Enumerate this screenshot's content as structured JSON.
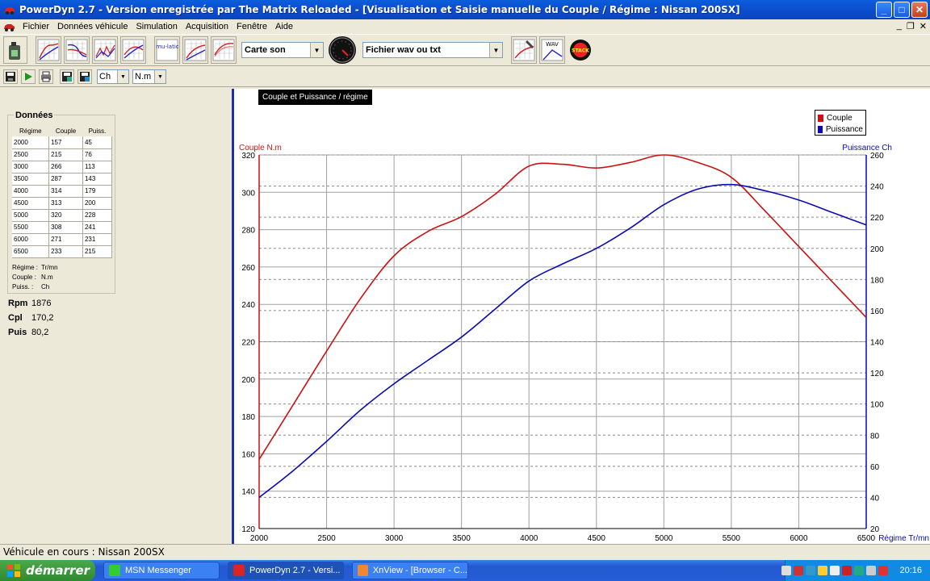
{
  "window": {
    "title": "PowerDyn 2.7 - Version enregistrée par The Matrix Reloaded - [Visualisation et Saisie manuelle du Couple / Régime : Nissan 200SX]",
    "minimize": "_",
    "maximize": "□",
    "close": "✕"
  },
  "menu": {
    "items": [
      "Fichier",
      "Données véhicule",
      "Simulation",
      "Acquisition",
      "Fenêtre",
      "Aide"
    ],
    "mdi_minimize": "_",
    "mdi_restore": "❐",
    "mdi_close": "✕"
  },
  "toolbar": {
    "sound_source": "Carte son",
    "file_source": "Fichier wav ou txt",
    "simulation_label": "simu-lation",
    "wav_label": "WAV",
    "stack_label": "STACK"
  },
  "toolbar2": {
    "power_unit": "Ch",
    "torque_unit": "N.m"
  },
  "panel": {
    "title": "Données",
    "headers": [
      "Régime",
      "Couple",
      "Puiss."
    ],
    "rows": [
      [
        "2000",
        "157",
        "45"
      ],
      [
        "2500",
        "215",
        "76"
      ],
      [
        "3000",
        "266",
        "113"
      ],
      [
        "3500",
        "287",
        "143"
      ],
      [
        "4000",
        "314",
        "179"
      ],
      [
        "4500",
        "313",
        "200"
      ],
      [
        "5000",
        "320",
        "228"
      ],
      [
        "5500",
        "308",
        "241"
      ],
      [
        "6000",
        "271",
        "231"
      ],
      [
        "6500",
        "233",
        "215"
      ]
    ],
    "units": [
      {
        "label": "Régime :",
        "value": "Tr/mn"
      },
      {
        "label": "Couple :",
        "value": "N.m"
      },
      {
        "label": "Puiss. :",
        "value": "Ch"
      }
    ],
    "readouts": [
      {
        "label": "Rpm",
        "value": "1876"
      },
      {
        "label": "Cpl",
        "value": "170,2"
      },
      {
        "label": "Puis",
        "value": "80,2"
      }
    ]
  },
  "chart_data": {
    "type": "line",
    "title": "Couple et Puissance / régime",
    "xlabel": "Régime Tr/mn",
    "ylabel_left": "Couple N.m",
    "ylabel_right": "Puissance Ch",
    "xlim": [
      2000,
      6500
    ],
    "ylim_left": [
      120,
      320
    ],
    "ylim_right": [
      20,
      260
    ],
    "x_ticks": [
      2000,
      2500,
      3000,
      3500,
      4000,
      4500,
      5000,
      5500,
      6000,
      6500
    ],
    "y_ticks_left": [
      120,
      140,
      160,
      180,
      200,
      220,
      240,
      260,
      280,
      300,
      320
    ],
    "y_ticks_right": [
      20,
      40,
      60,
      80,
      100,
      120,
      140,
      160,
      180,
      200,
      220,
      240,
      260
    ],
    "grid": true,
    "legend_position": "top-right",
    "x": [
      2000,
      2250,
      2500,
      2750,
      3000,
      3250,
      3500,
      3750,
      4000,
      4250,
      4500,
      4750,
      5000,
      5250,
      5500,
      5750,
      6000,
      6250,
      6500
    ],
    "series": [
      {
        "name": "Couple",
        "axis": "left",
        "color": "#cc1111",
        "values": [
          157,
          186,
          215,
          243,
          266,
          279,
          287,
          299,
          314,
          315,
          313,
          316,
          320,
          316,
          308,
          290,
          271,
          252,
          233
        ]
      },
      {
        "name": "Puissance",
        "axis": "right",
        "color": "#0a0ab4",
        "values": [
          40,
          57,
          76,
          96,
          113,
          128,
          143,
          161,
          179,
          190,
          200,
          213,
          228,
          238,
          241,
          237,
          231,
          223,
          215
        ]
      }
    ]
  },
  "status": {
    "text": "Véhicule en cours : Nissan 200SX"
  },
  "taskbar": {
    "start": "démarrer",
    "tasks": [
      "MSN Messenger",
      "PowerDyn 2.7 - Versi...",
      "XnView - [Browser - C..."
    ],
    "clock": "20:16"
  }
}
